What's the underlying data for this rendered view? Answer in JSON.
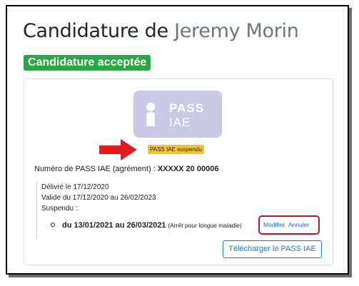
{
  "header": {
    "title_prefix": "Candidature de ",
    "title_name": "Jeremy Morin",
    "status_badge": "Candidature acceptée"
  },
  "pass": {
    "logo_line1": "PASS",
    "logo_line2": "IAE",
    "status_badge": "PASS IAE suspendu",
    "numero_label": "Numéro de PASS IAE (agrément) : ",
    "numero_value": "XXXXX 20 00006",
    "delivered": "Délivré le 17/12/2020",
    "valid": "Valide du 17/12/2020 au 26/02/2023",
    "suspended_label": "Suspendu :",
    "suspension": {
      "period": "du 13/01/2021 au 26/03/2021",
      "reason": "(Arrêt pour longue maladie)"
    },
    "modify_label": "Modifier",
    "cancel_label": "Annuler",
    "download_label": "Télécharger le PASS IAE"
  },
  "colors": {
    "accepted_badge": "#28a745",
    "suspended_badge": "#f6c22d",
    "link": "#0d6efd",
    "highlight_box": "#c8102e",
    "arrow": "#e31b1b",
    "logo_bg": "#c8c9e6"
  }
}
